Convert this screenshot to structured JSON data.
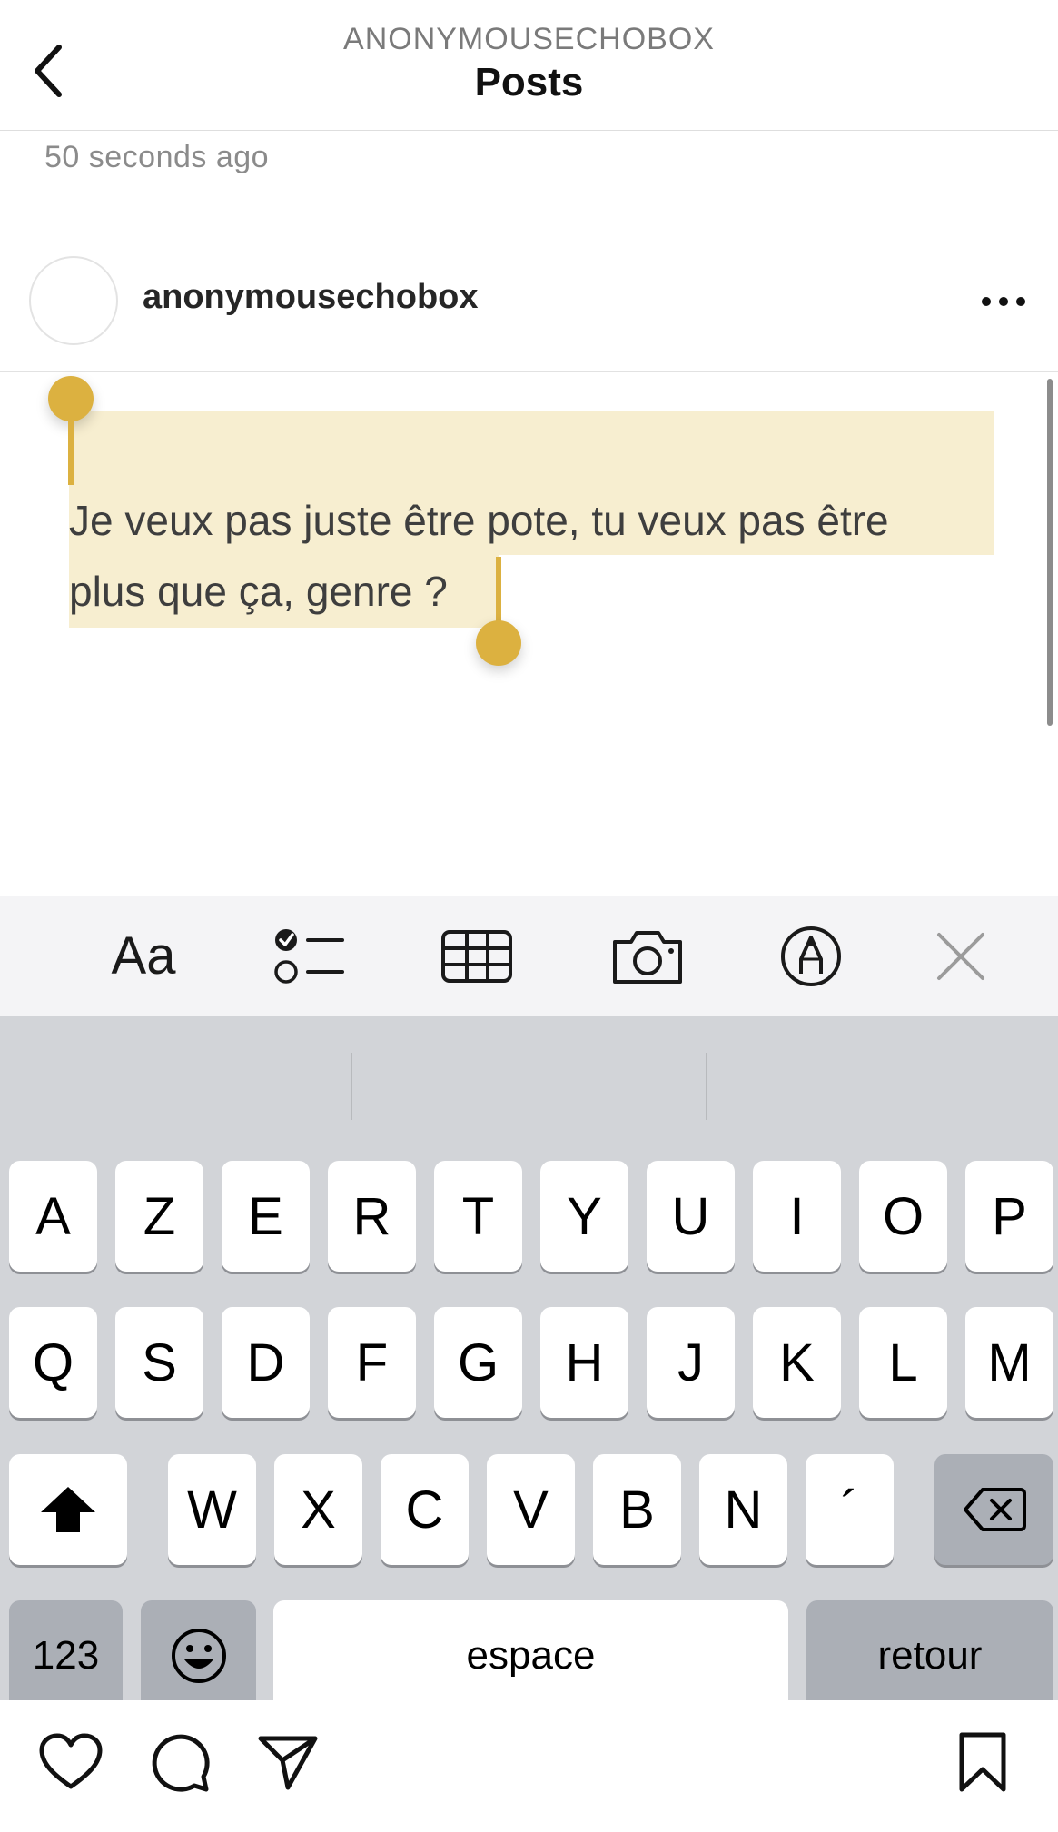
{
  "header": {
    "account": "ANONYMOUSECHOBOX",
    "title": "Posts"
  },
  "post": {
    "timestamp": "50 seconds ago",
    "author": "anonymousechobox",
    "text_line1": "Je veux pas juste être pote, tu veux pas être",
    "text_line2": "plus que ça, genre ?"
  },
  "toolbar": {
    "text_format_label": "Aa",
    "icons": [
      "text-format-icon",
      "checklist-icon",
      "table-icon",
      "camera-icon",
      "markup-pen-icon",
      "close-icon"
    ]
  },
  "keyboard": {
    "row1": [
      "A",
      "Z",
      "E",
      "R",
      "T",
      "Y",
      "U",
      "I",
      "O",
      "P"
    ],
    "row2": [
      "Q",
      "S",
      "D",
      "F",
      "G",
      "H",
      "J",
      "K",
      "L",
      "M"
    ],
    "row3": [
      "W",
      "X",
      "C",
      "V",
      "B",
      "N",
      "´"
    ],
    "numbers_label": "123",
    "space_label": "espace",
    "return_label": "retour"
  },
  "bottom_bar": {
    "icons": [
      "heart-icon",
      "comment-icon",
      "share-icon",
      "bookmark-icon"
    ]
  },
  "colors": {
    "selection_handle": "#dcb140",
    "selection_highlight": "#f7eed0",
    "keyboard_bg": "#d2d4d8",
    "toolbar_bg": "#f4f4f6"
  }
}
